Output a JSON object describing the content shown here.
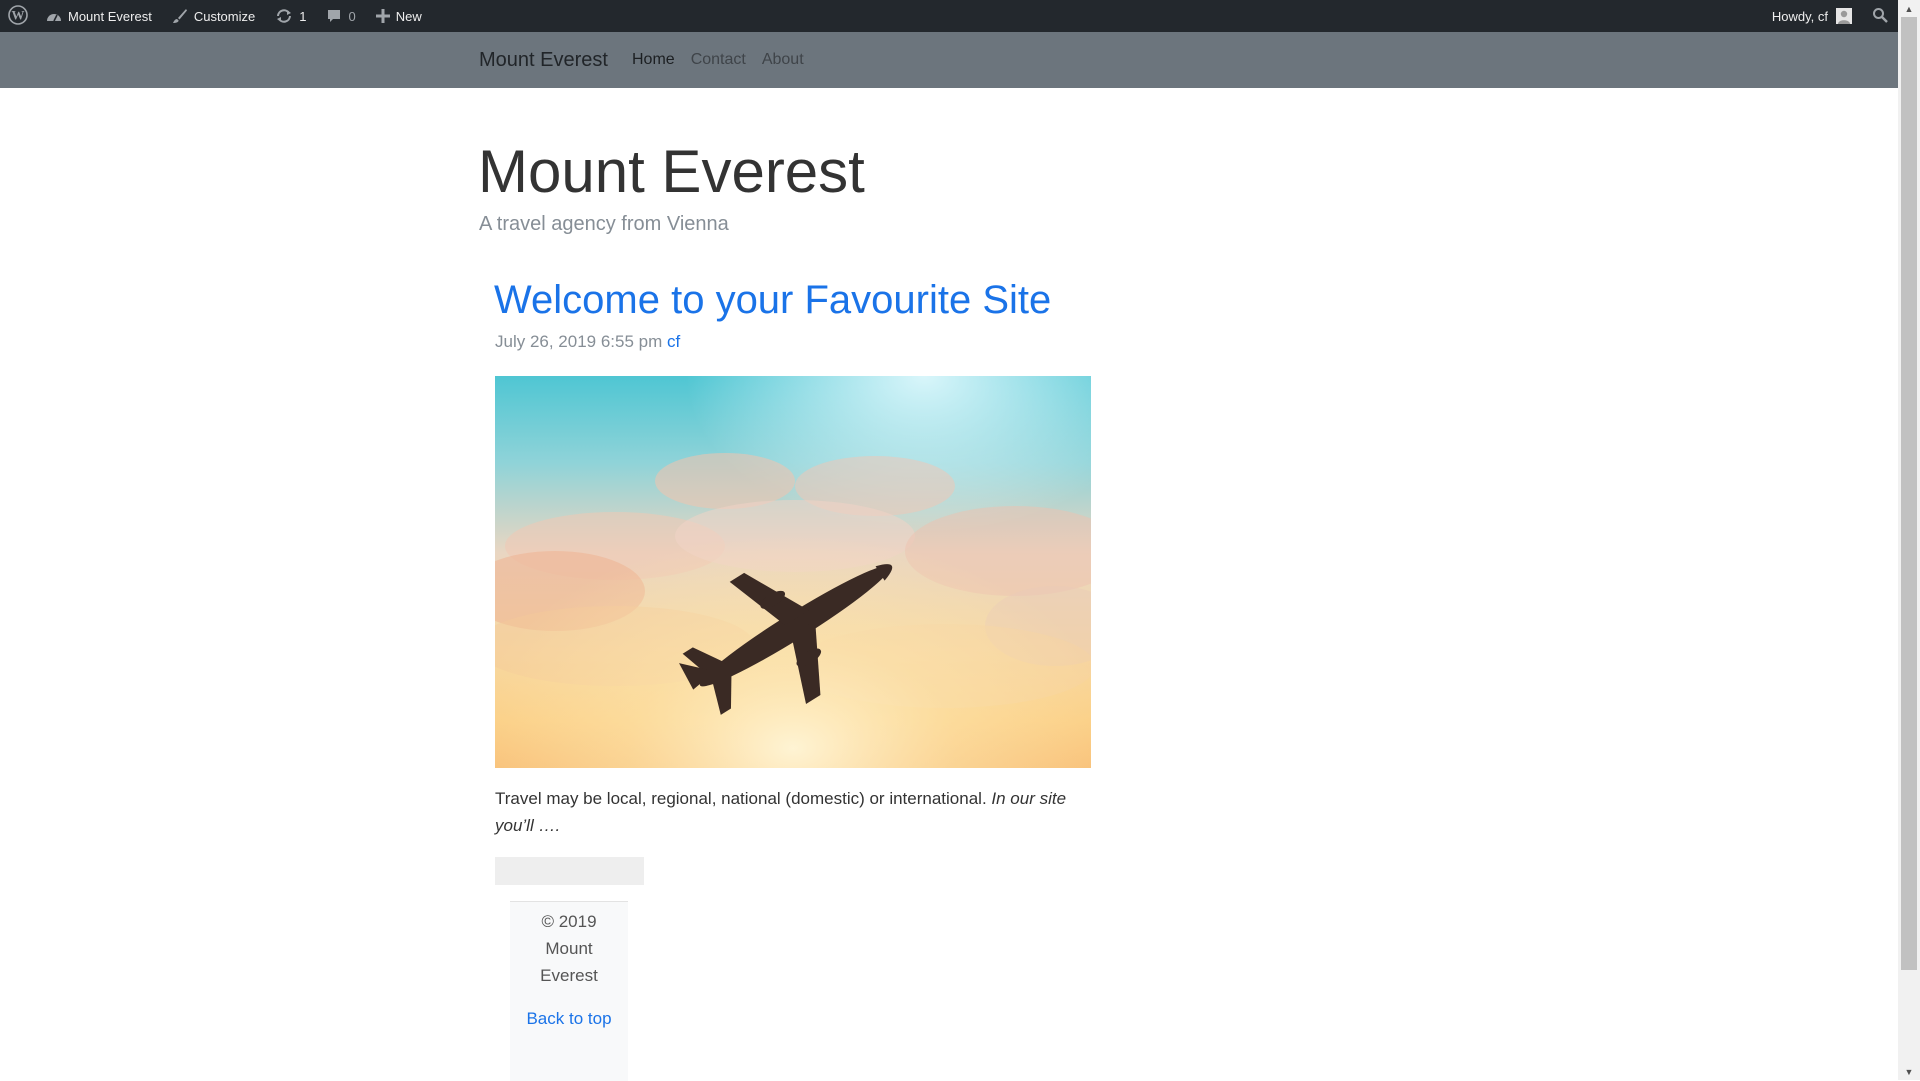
{
  "adminbar": {
    "site_name": "Mount Everest",
    "customize_label": "Customize",
    "updates_count": "1",
    "comments_count": "0",
    "new_label": "New",
    "greeting": "Howdy, cf"
  },
  "navbar": {
    "brand": "Mount Everest",
    "links": [
      {
        "label": "Home",
        "active": true
      },
      {
        "label": "Contact",
        "active": false
      },
      {
        "label": "About",
        "active": false
      }
    ]
  },
  "header": {
    "title": "Mount Everest",
    "tagline": "A travel agency from Vienna"
  },
  "post": {
    "title": "Welcome to your Favourite Site",
    "date": "July 26, 2019 6:55 pm",
    "author": "cf",
    "excerpt_plain": "Travel may be local, regional, national (domestic) or international.",
    "excerpt_italic": "In our site you’ll ….",
    "image_icon": "airplane-sky-photo"
  },
  "footer": {
    "copyright": "© 2019 Mount Everest",
    "back_to_top": "Back to top"
  },
  "colors": {
    "adminbar_bg": "#23282d",
    "navbar_bg": "#6c757d",
    "link": "#1a73e8",
    "muted": "#868e96"
  }
}
